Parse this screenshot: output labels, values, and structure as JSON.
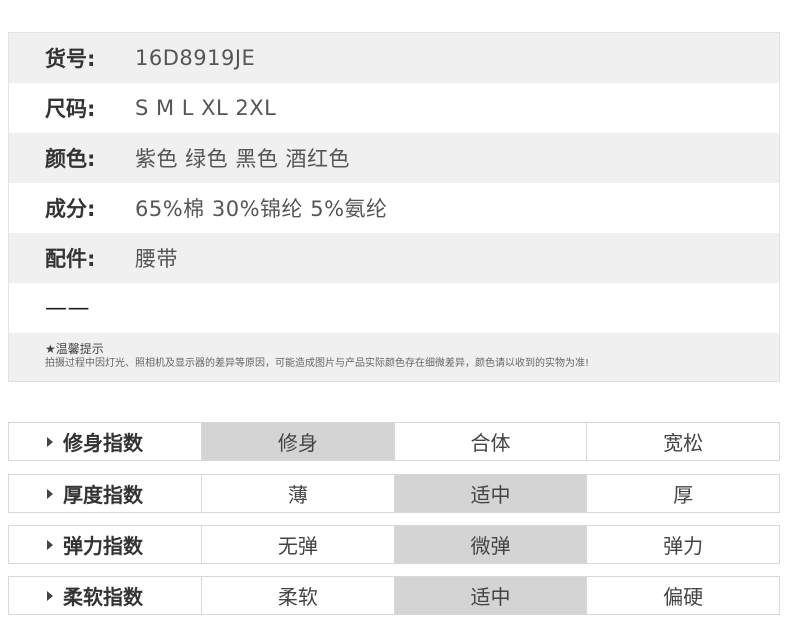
{
  "spec": {
    "item_no_label": "货号:",
    "item_no_value": "16D8919JE",
    "size_label": "尺码:",
    "size_value": "S M L XL 2XL",
    "color_label": "颜色:",
    "color_value": "紫色 绿色 黑色 酒红色",
    "material_label": "成分:",
    "material_value": "65%棉  30%锦纶  5%氨纶",
    "accessory_label": "配件:",
    "accessory_value": "腰带",
    "extra_value": "——",
    "tip_title": "★温馨提示",
    "tip_text": "拍摄过程中因灯光、照相机及显示器的差异等原因，可能造成图片与产品实际颜色存在细微差异，颜色请以收到的实物为准!"
  },
  "indices": [
    {
      "label": "修身指数",
      "options": [
        "修身",
        "合体",
        "宽松"
      ],
      "selected": 0
    },
    {
      "label": "厚度指数",
      "options": [
        "薄",
        "适中",
        "厚"
      ],
      "selected": 1
    },
    {
      "label": "弹力指数",
      "options": [
        "无弹",
        "微弹",
        "弹力"
      ],
      "selected": 1
    },
    {
      "label": "柔软指数",
      "options": [
        "柔软",
        "适中",
        "偏硬"
      ],
      "selected": 1
    }
  ]
}
